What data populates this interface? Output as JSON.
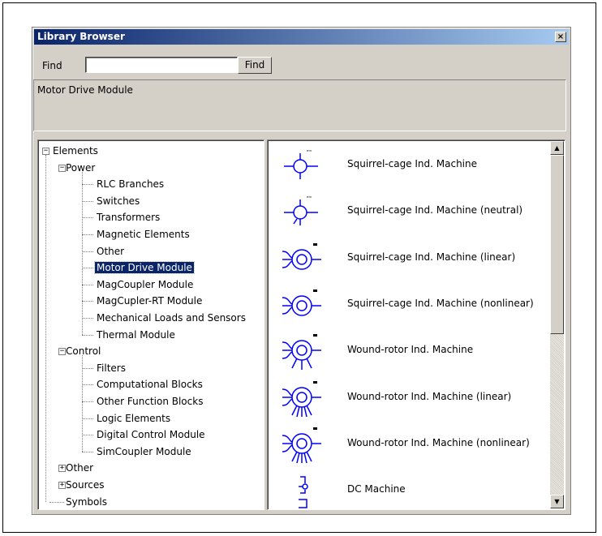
{
  "window": {
    "title": "Library Browser",
    "close_glyph": "×"
  },
  "find": {
    "label": "Find",
    "value": "",
    "button_label": "Find"
  },
  "description": "Motor Drive Module",
  "tree": [
    {
      "label": "Elements",
      "level": 0,
      "expander": "minus"
    },
    {
      "label": "Power",
      "level": 1,
      "expander": "minus"
    },
    {
      "label": "RLC Branches",
      "level": 2
    },
    {
      "label": "Switches",
      "level": 2
    },
    {
      "label": "Transformers",
      "level": 2
    },
    {
      "label": "Magnetic Elements",
      "level": 2
    },
    {
      "label": "Other",
      "level": 2
    },
    {
      "label": "Motor Drive Module",
      "level": 2,
      "selected": true
    },
    {
      "label": "MagCoupler Module",
      "level": 2
    },
    {
      "label": "MagCupler-RT Module",
      "level": 2
    },
    {
      "label": "Mechanical Loads and Sensors",
      "level": 2
    },
    {
      "label": "Thermal Module",
      "level": 2
    },
    {
      "label": "Control",
      "level": 1,
      "expander": "minus"
    },
    {
      "label": "Filters",
      "level": 2
    },
    {
      "label": "Computational Blocks",
      "level": 2
    },
    {
      "label": "Other Function Blocks",
      "level": 2
    },
    {
      "label": "Logic Elements",
      "level": 2
    },
    {
      "label": "Digital Control Module",
      "level": 2
    },
    {
      "label": "SimCoupler Module",
      "level": 2
    },
    {
      "label": "Other",
      "level": 1,
      "expander": "plus"
    },
    {
      "label": "Sources",
      "level": 1,
      "expander": "plus"
    },
    {
      "label": "Symbols",
      "level": 1
    }
  ],
  "elements": [
    {
      "label": "Squirrel-cage Ind. Machine",
      "icon": "squirrel-cage-machine-icon"
    },
    {
      "label": "Squirrel-cage Ind. Machine (neutral)",
      "icon": "squirrel-cage-neutral-icon"
    },
    {
      "label": "Squirrel-cage Ind. Machine (linear)",
      "icon": "squirrel-cage-linear-icon"
    },
    {
      "label": "Squirrel-cage Ind. Machine (nonlinear)",
      "icon": "squirrel-cage-nonlinear-icon"
    },
    {
      "label": "Wound-rotor Ind. Machine",
      "icon": "wound-rotor-machine-icon"
    },
    {
      "label": "Wound-rotor Ind. Machine (linear)",
      "icon": "wound-rotor-linear-icon"
    },
    {
      "label": "Wound-rotor Ind. Machine (nonlinear)",
      "icon": "wound-rotor-nonlinear-icon"
    },
    {
      "label": "DC Machine",
      "icon": "dc-machine-icon"
    }
  ],
  "scrollbar": {
    "up_glyph": "▲",
    "down_glyph": "▼"
  },
  "colors": {
    "titlebar": "#0a246a",
    "selection": "#0a246a",
    "symbol": "#0000ff",
    "face": "#d4d0c8"
  }
}
